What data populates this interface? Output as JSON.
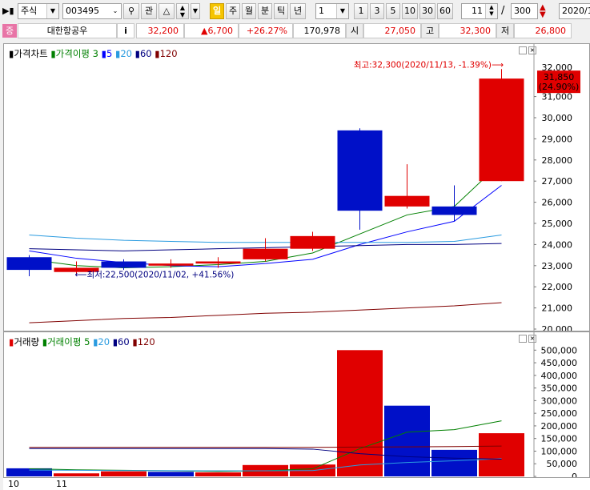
{
  "toolbar": {
    "market": "주식",
    "code": "003495",
    "watch": "관",
    "period_buttons": [
      "일",
      "주",
      "월",
      "분",
      "틱",
      "년"
    ],
    "interval_value": "1",
    "interval_buttons": [
      "1",
      "3",
      "5",
      "10",
      "30",
      "60"
    ],
    "count_value": "11",
    "separator": "/",
    "total_value": "300",
    "date_value": "2020/1"
  },
  "quote": {
    "badge": "증",
    "name": "대한항공우",
    "info": "i",
    "price": "32,200",
    "change": "▲6,700",
    "change_pct": "+26.27%",
    "volume": "170,978",
    "open_label": "시",
    "open": "27,050",
    "high_label": "고",
    "high": "32,300",
    "low_label": "저",
    "low": "26,800"
  },
  "price_legend": {
    "title": "가격차트",
    "ma_label": "가격이평",
    "periods": [
      "3",
      "5",
      "20",
      "60",
      "120"
    ],
    "colors": [
      "#008000",
      "#0000ff",
      "#2a9be0",
      "#000080",
      "#800000"
    ]
  },
  "volume_legend": {
    "title": "거래량",
    "ma_label": "거래이평",
    "periods": [
      "5",
      "20",
      "60",
      "120"
    ],
    "colors": [
      "#008000",
      "#2a9be0",
      "#000080",
      "#800000"
    ]
  },
  "annotations": {
    "high_note": "최고:32,300(2020/11/13, -1.39%)",
    "low_note": "최저:22,500(2020/11/02, +41.56%)",
    "current_price": "31,850",
    "current_pct": "(24.90%)",
    "axis_top_hidden": "32,000"
  },
  "x_labels": [
    "10",
    "11"
  ],
  "chart_data": [
    {
      "type": "candlestick",
      "title": "가격차트",
      "ylim": [
        20000,
        32500
      ],
      "y_ticks": [
        "31,000",
        "30,000",
        "29,000",
        "28,000",
        "27,000",
        "26,000",
        "25,000",
        "24,000",
        "23,000",
        "22,000",
        "21,000",
        "20,000"
      ],
      "candles": [
        {
          "open": 23400,
          "close": 22800,
          "high": 23500,
          "low": 22500
        },
        {
          "open": 22700,
          "close": 22900,
          "high": 23200,
          "low": 22600
        },
        {
          "open": 23200,
          "close": 22900,
          "high": 23300,
          "low": 22800
        },
        {
          "open": 23000,
          "close": 23100,
          "high": 23300,
          "low": 22900
        },
        {
          "open": 23100,
          "close": 23200,
          "high": 23400,
          "low": 22900
        },
        {
          "open": 23300,
          "close": 23800,
          "high": 24300,
          "low": 23200
        },
        {
          "open": 23800,
          "close": 24400,
          "high": 24600,
          "low": 23700
        },
        {
          "open": 29400,
          "close": 25600,
          "high": 29500,
          "low": 24700
        },
        {
          "open": 25800,
          "close": 26300,
          "high": 27800,
          "low": 25700
        },
        {
          "open": 25800,
          "close": 25400,
          "high": 26800,
          "low": 25100
        },
        {
          "open": 27000,
          "close": 31850,
          "high": 32300,
          "low": 27000
        }
      ],
      "series": [
        {
          "name": "3",
          "values": [
            23300,
            23000,
            22900,
            22950,
            23050,
            23200,
            23600,
            24500,
            25400,
            25800,
            27900
          ]
        },
        {
          "name": "5",
          "values": [
            23700,
            23350,
            23150,
            23000,
            22950,
            23100,
            23300,
            24000,
            24600,
            25100,
            26800
          ]
        },
        {
          "name": "20",
          "values": [
            24450,
            24300,
            24200,
            24150,
            24100,
            24100,
            24100,
            24100,
            24100,
            24150,
            24450
          ]
        },
        {
          "name": "60",
          "values": [
            23800,
            23750,
            23700,
            23750,
            23800,
            23850,
            23900,
            23950,
            24000,
            24000,
            24050
          ]
        },
        {
          "name": "120",
          "values": [
            20300,
            20400,
            20500,
            20550,
            20650,
            20750,
            20800,
            20900,
            21000,
            21100,
            21250
          ]
        }
      ]
    },
    {
      "type": "bar",
      "title": "거래량",
      "ylim": [
        0,
        520000
      ],
      "y_ticks": [
        "500,000",
        "450,000",
        "400,000",
        "350,000",
        "300,000",
        "250,000",
        "200,000",
        "150,000",
        "100,000",
        "50,000",
        "0"
      ],
      "values": [
        32000,
        12000,
        20000,
        18000,
        16000,
        45000,
        47000,
        500000,
        280000,
        105000,
        170978
      ],
      "up": [
        false,
        true,
        true,
        false,
        true,
        true,
        true,
        true,
        false,
        false,
        true
      ],
      "series": [
        {
          "name": "5",
          "values": [
            30000,
            26000,
            24000,
            22000,
            20000,
            22000,
            30000,
            110000,
            175000,
            185000,
            220000
          ]
        },
        {
          "name": "20",
          "values": [
            25000,
            24000,
            23000,
            23000,
            22000,
            22000,
            23000,
            45000,
            55000,
            62000,
            70000
          ]
        },
        {
          "name": "60",
          "values": [
            110000,
            110000,
            110000,
            110000,
            110000,
            110000,
            108000,
            90000,
            78000,
            72000,
            68000
          ]
        },
        {
          "name": "120",
          "values": [
            115000,
            115000,
            115000,
            115000,
            115000,
            115000,
            115000,
            116000,
            117000,
            118000,
            120000
          ]
        }
      ]
    }
  ]
}
